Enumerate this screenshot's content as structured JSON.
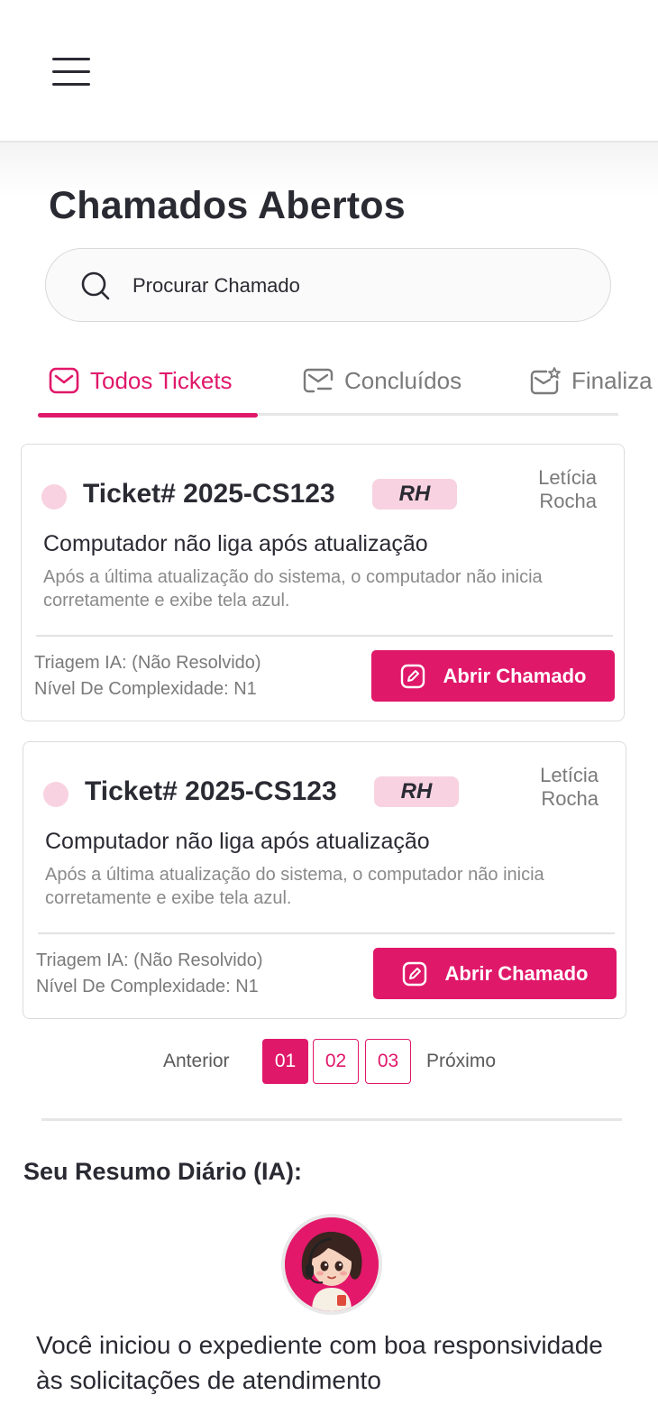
{
  "header": {
    "menu_icon": "hamburger-menu-icon"
  },
  "page": {
    "title": "Chamados Abertos"
  },
  "search": {
    "placeholder": "Procurar Chamado",
    "icon": "search-icon"
  },
  "tabs": [
    {
      "label": "Todos Tickets",
      "icon": "mail-icon",
      "active": true
    },
    {
      "label": "Concluídos",
      "icon": "mail-check-icon",
      "active": false
    },
    {
      "label": "Finaliza",
      "icon": "mail-star-icon",
      "active": false
    }
  ],
  "tickets": [
    {
      "id": "Ticket# 2025-CS123",
      "department": "RH",
      "assignee": "Letícia Rocha",
      "subject": "Computador não liga após atualização",
      "description": "Após a última atualização do sistema, o computador não inicia corretamente e exibe tela azul.",
      "triage": "Triagem IA: (Não Resolvido)",
      "complexity": "Nível De Complexidade: N1",
      "button_label": "Abrir Chamado"
    },
    {
      "id": "Ticket# 2025-CS123",
      "department": "RH",
      "assignee": "Letícia Rocha",
      "subject": "Computador não liga após atualização",
      "description": "Após a última atualização do sistema, o computador não inicia corretamente e exibe tela azul.",
      "triage": "Triagem IA: (Não Resolvido)",
      "complexity": "Nível De Complexidade: N1",
      "button_label": "Abrir Chamado"
    }
  ],
  "pagination": {
    "prev_label": "Anterior",
    "next_label": "Próximo",
    "pages": [
      "01",
      "02",
      "03"
    ],
    "current": "01"
  },
  "summary": {
    "title": "Seu Resumo Diário (IA):",
    "text": "Você iniciou o expediente com boa responsividade às solicitações de atendimento"
  },
  "colors": {
    "accent": "#e0186a",
    "accent_light": "#f8d2e0",
    "text": "#2a2a33",
    "muted": "#7a7a7a"
  }
}
